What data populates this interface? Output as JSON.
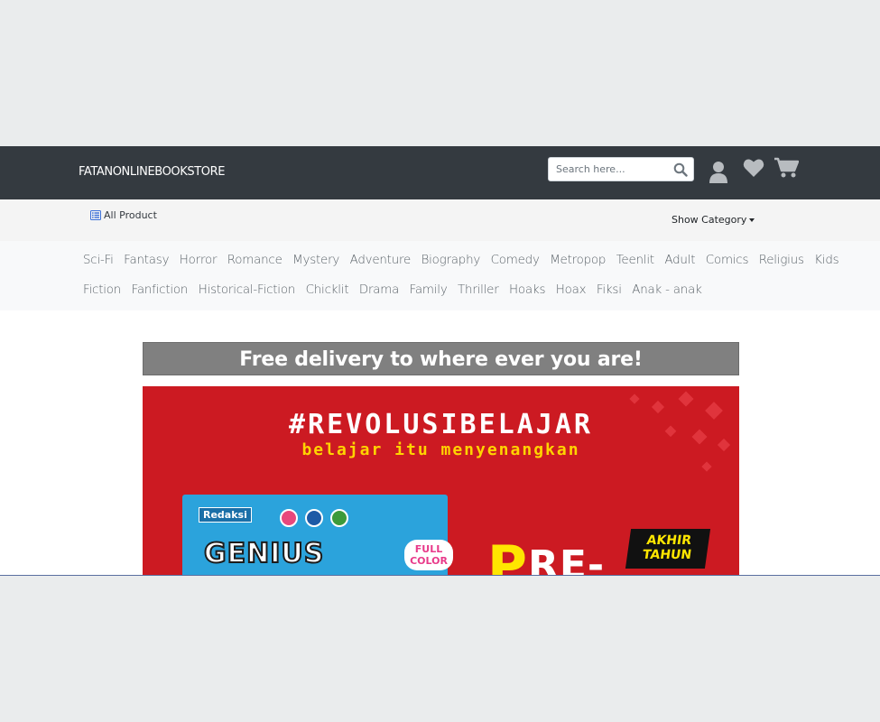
{
  "navbar": {
    "brand": "FATANONLINEBOOKSTORE",
    "search_placeholder": "Search here...",
    "icons": [
      "search-icon",
      "user-icon",
      "heart-icon",
      "cart-icon"
    ],
    "background": "#343a40"
  },
  "subbar": {
    "all_product": "All Product",
    "show_category": "Show Category"
  },
  "categories": {
    "row1": [
      "Sci-Fi",
      "Fantasy",
      "Horror",
      "Romance",
      "Mystery",
      "Adventure",
      "Biography",
      "Comedy",
      "Metropop",
      "Teenlit",
      "Adult",
      "Comics",
      "Religius",
      "Kids"
    ],
    "row2": [
      "Fiction",
      "Fanfiction",
      "Historical-Fiction",
      "Chicklit",
      "Drama",
      "Family",
      "Thriller",
      "Hoaks",
      "Hoax",
      "Fiksi",
      "Anak - anak"
    ]
  },
  "delivery_banner": "Free delivery to where ever you are!",
  "promo": {
    "hashtag": "#REVOLUSIBELAJAR",
    "tagline": "belajar itu menyenangkan",
    "book_brand": "Redaksi",
    "book_title": "GENIUS",
    "book_badge_line1": "FULL",
    "book_badge_line2": "COLOR",
    "pre_p": "P",
    "pre_rest": "RE-",
    "akhir_line1": "AKHIR",
    "akhir_line2": "TAHUN",
    "background": "#cc1a22"
  }
}
